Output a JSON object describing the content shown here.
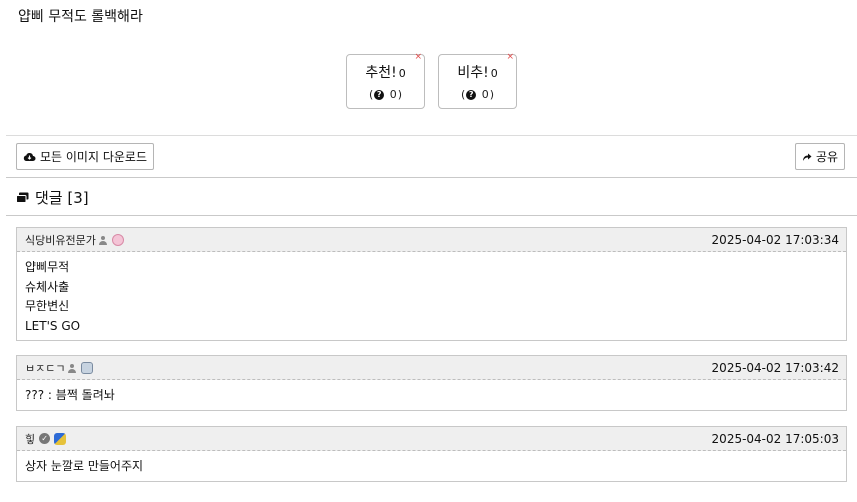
{
  "post": {
    "text": "얍삐 무적도 롤백해라"
  },
  "votes": {
    "up": {
      "label": "추천!",
      "count": "0",
      "sub_count": "0",
      "close": "×"
    },
    "down": {
      "label": "비추!",
      "count": "0",
      "sub_count": "0",
      "close": "×"
    }
  },
  "toolbar": {
    "download_label": "모든 이미지 다운로드",
    "share_label": "공유"
  },
  "comments_header": {
    "title": "댓글 [3]"
  },
  "comments": [
    {
      "author": "식당비유전문가",
      "time": "2025-04-02 17:03:34",
      "lines": [
        "얍삐무적",
        "슈체사출",
        "무한변신",
        "LET'S GO"
      ]
    },
    {
      "author": "ㅂㅈㄷㄱ",
      "time": "2025-04-02 17:03:42",
      "lines": [
        "??? : 븜쩍 돌려놔"
      ]
    },
    {
      "author": "힣",
      "time": "2025-04-02 17:05:03",
      "lines": [
        "상자 눈깔로 만들어주지"
      ]
    }
  ]
}
